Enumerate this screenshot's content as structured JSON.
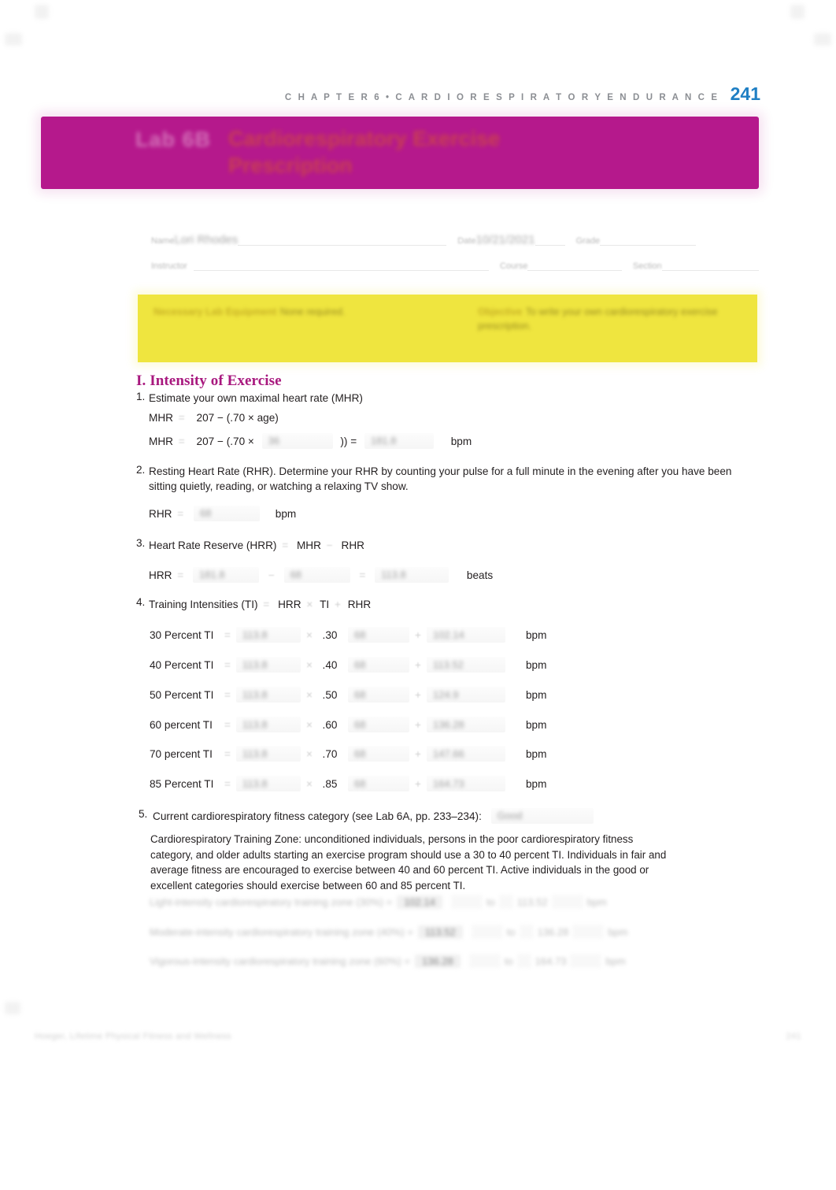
{
  "page": {
    "running_head": "C H A P T E R 6 • C A R D I O R E S P I R A T O R Y E N D U R A N C E",
    "page_number": "241",
    "accent_magenta": "#b5198c",
    "accent_heading": "#a8187e",
    "accent_yellow": "#efe53f",
    "accent_page_number": "#1f7fc4"
  },
  "banner": {
    "lab_number": "Lab 6B",
    "title": "Cardiorespiratory Exercise Prescription"
  },
  "identification": {
    "name_label": "Name",
    "name_value": "Lori Rhodes",
    "date_label": "Date",
    "date_value": "10/21/2021",
    "grade_label": "Grade",
    "grade_value": "",
    "instructor_label": "Instructor",
    "instructor_value": "",
    "course_label": "Course",
    "course_value": "",
    "section_label": "Section",
    "section_value": ""
  },
  "objective_box": {
    "left_head": "Necessary Lab Equipment",
    "left_body": "None required.",
    "right_head": "Objective",
    "right_body": "To write your own cardiorespiratory exercise prescription."
  },
  "section": {
    "heading": "I. Intensity of Exercise"
  },
  "items": {
    "item1": {
      "number": "1.",
      "text": "Estimate your own maximal heart rate (MHR)",
      "formula_label": "MHR",
      "formula_eq": "=",
      "formula_text": "207 − (.70 × age)",
      "calc_label": "MHR",
      "calc_eq": "=",
      "calc_prefix": "207 − (.70 ×",
      "age_value": "36",
      "calc_suffix": "))  =",
      "result_value": "181.8",
      "unit": "bpm"
    },
    "item2": {
      "number": "2.",
      "text": "Resting Heart Rate (RHR). Determine your RHR by counting your pulse for a full minute in the evening after you have been sitting quietly, reading, or watching a relaxing TV show.",
      "label": "RHR",
      "eq": "=",
      "value": "68",
      "unit": "bpm"
    },
    "item3": {
      "number": "3.",
      "text": "Heart Rate Reserve (HRR)",
      "eq": "=",
      "term1": "MHR",
      "minus": "−",
      "term2": "RHR",
      "label": "HRR",
      "row_eq": "=",
      "mhr_value": "181.8",
      "row_minus": "−",
      "rhr_value": "68",
      "row_eq2": "=",
      "result_value": "113.8",
      "unit": "beats"
    },
    "item4": {
      "number": "4.",
      "text": "Training Intensities (TI)",
      "eq": "=",
      "term1": "HRR",
      "times": "×",
      "term2": "TI",
      "plus": "+",
      "term3": "RHR",
      "unit": "bpm",
      "rows": [
        {
          "label": "30 Percent TI",
          "eq": "=",
          "hrr": "113.8",
          "times": "×",
          "factor": ".30",
          "plus": "+",
          "rhr": "68",
          "eq2": "=",
          "result": "102.14"
        },
        {
          "label": "40 Percent TI",
          "eq": "=",
          "hrr": "113.8",
          "times": "×",
          "factor": ".40",
          "plus": "+",
          "rhr": "68",
          "eq2": "=",
          "result": "113.52"
        },
        {
          "label": "50 Percent TI",
          "eq": "=",
          "hrr": "113.8",
          "times": "×",
          "factor": ".50",
          "plus": "+",
          "rhr": "68",
          "eq2": "=",
          "result": "124.9"
        },
        {
          "label": "60 percent TI",
          "eq": "=",
          "hrr": "113.8",
          "times": "×",
          "factor": ".60",
          "plus": "+",
          "rhr": "68",
          "eq2": "=",
          "result": "136.28"
        },
        {
          "label": "70 percent TI",
          "eq": "=",
          "hrr": "113.8",
          "times": "×",
          "factor": ".70",
          "plus": "+",
          "rhr": "68",
          "eq2": "=",
          "result": "147.66"
        },
        {
          "label": "85 Percent TI",
          "eq": "=",
          "hrr": "113.8",
          "times": "×",
          "factor": ".85",
          "plus": "+",
          "rhr": "68",
          "eq2": "=",
          "result": "164.73"
        }
      ]
    },
    "item5": {
      "number": "5.",
      "text": "Current cardiorespiratory fitness category (see Lab 6A, pp. 233–234):",
      "category_value": "Good",
      "paragraph": "Cardiorespiratory Training Zone: unconditioned individuals, persons in the poor cardiorespiratory fitness category, and older adults starting an exercise program should use a 30 to 40 percent TI. Individuals in fair and average fitness are encouraged to exercise between 40 and 60 percent TI. Active individuals in the good or excellent categories should exercise between 60 and 85 percent TI."
    },
    "duration_rows": [
      {
        "text": "Light-intensity cardiorespiratory training zone (30%) =",
        "value": "102.14",
        "connector": "to",
        "value2": "113.52",
        "unit": "bpm"
      },
      {
        "text": "Moderate-intensity cardiorespiratory training zone (40%) =",
        "value": "113.52",
        "connector": "to",
        "value2": "136.28",
        "unit": "bpm"
      },
      {
        "text": "Vigorous-intensity cardiorespiratory training zone (60%) =",
        "value": "136.28",
        "connector": "to",
        "value2": "164.73",
        "unit": "bpm"
      }
    ]
  },
  "footer": {
    "left": "Hoeger, Lifetime Physical Fitness and Wellness",
    "right": "241"
  }
}
